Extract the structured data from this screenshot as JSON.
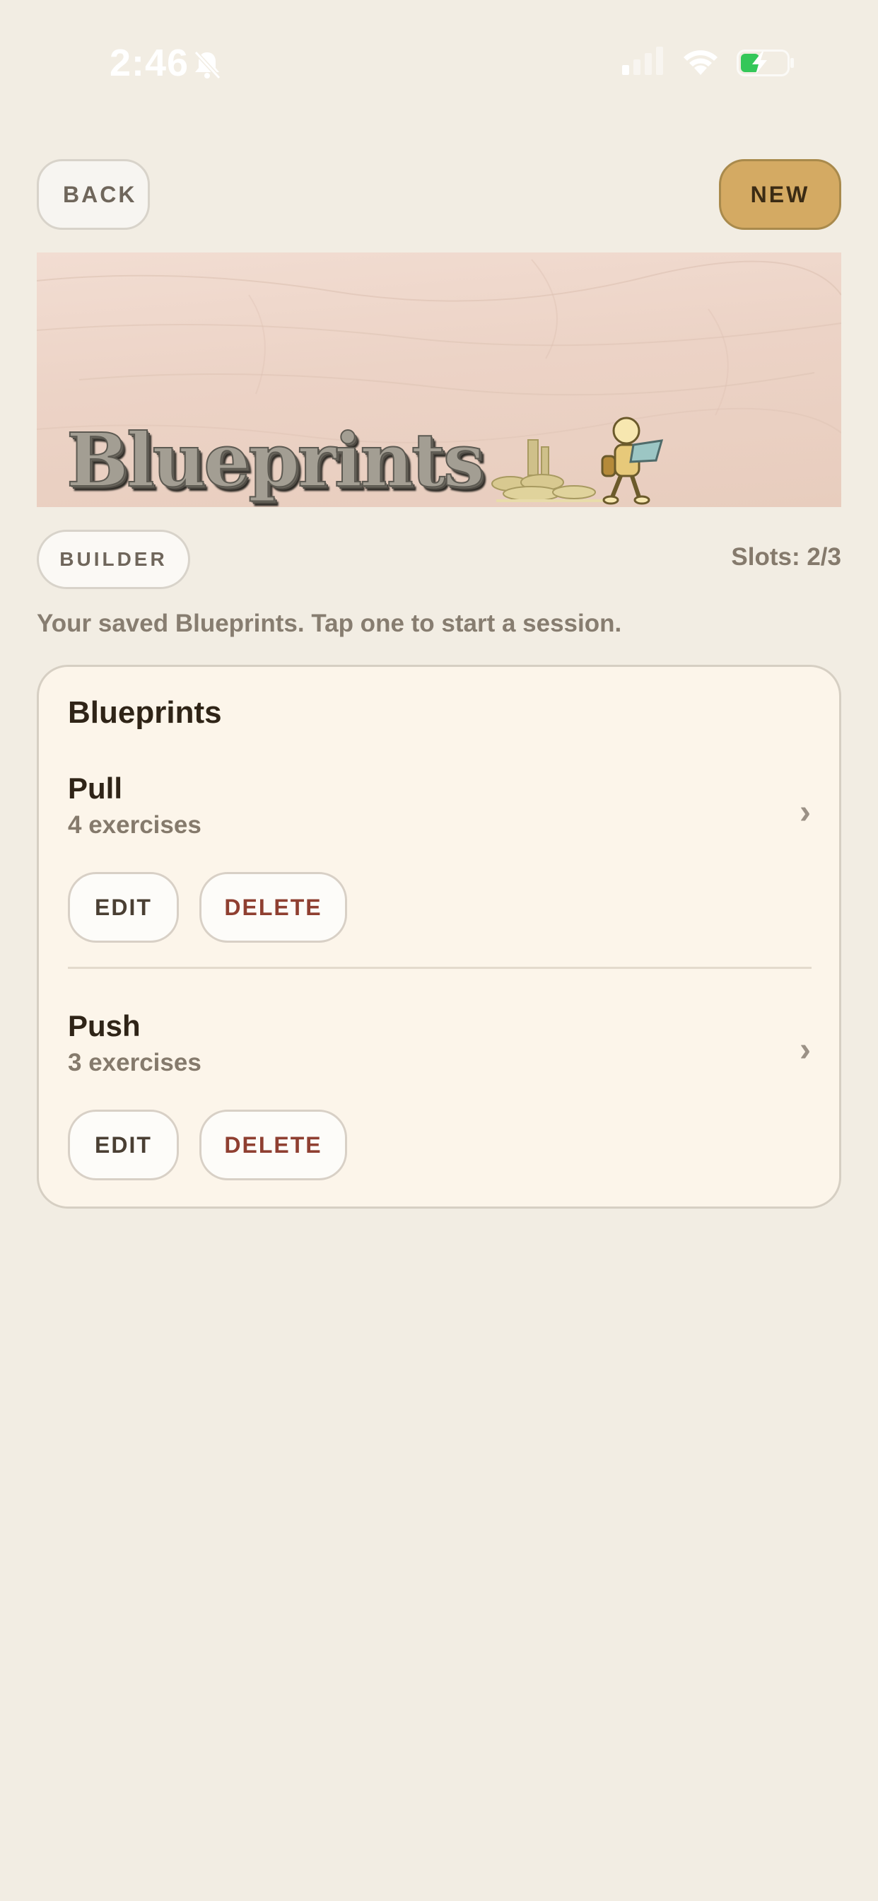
{
  "status_bar": {
    "time": "2:46",
    "icons": [
      "bell-slash-icon",
      "cellular-signal-icon",
      "wifi-icon",
      "battery-charging-icon"
    ]
  },
  "header": {
    "back_label": "BACK",
    "new_label": "NEW"
  },
  "banner": {
    "title": "Blueprints"
  },
  "meta": {
    "mode_badge": "BUILDER",
    "slots": "Slots: 2/3",
    "description": "Your saved Blueprints. Tap one to start a session."
  },
  "card": {
    "title": "Blueprints",
    "items": [
      {
        "name": "Pull",
        "count": "4 exercises",
        "edit_label": "EDIT",
        "delete_label": "DELETE"
      },
      {
        "name": "Push",
        "count": "3 exercises",
        "edit_label": "EDIT",
        "delete_label": "DELETE"
      }
    ]
  },
  "colors": {
    "background": "#f2ede3",
    "accent": "#d4aa63",
    "card": "#fcf5ea",
    "danger": "#8f3f31"
  }
}
